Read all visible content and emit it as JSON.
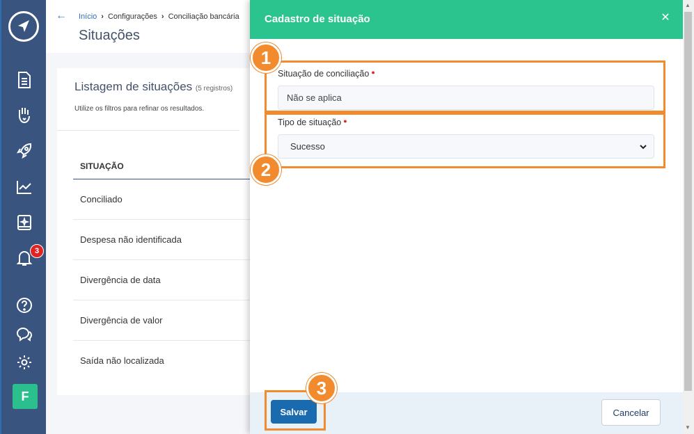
{
  "sidebar": {
    "badge_count": "3",
    "avatar_letter": "F"
  },
  "header": {
    "breadcrumb": {
      "home": "Início",
      "item2": "Configurações",
      "item3": "Conciliação bancária"
    },
    "page_title": "Situações"
  },
  "list": {
    "title": "Listagem de situações",
    "count": "(5 registros)",
    "subtitle": "Utilize os filtros para refinar os resultados.",
    "column_header": "SITUAÇÃO",
    "rows": [
      "Conciliado",
      "Despesa não identificada",
      "Divergência de data",
      "Divergência de valor",
      "Saída não localizada"
    ]
  },
  "modal": {
    "title": "Cadastro de situação",
    "field1_label": "Situação de conciliação",
    "field1_value": "Não se aplica",
    "field2_label": "Tipo de situação",
    "field2_value": "Sucesso",
    "save_label": "Salvar",
    "cancel_label": "Cancelar"
  },
  "annotations": {
    "n1": "1",
    "n2": "2",
    "n3": "3"
  },
  "colors": {
    "accent": "#2bc38e",
    "sidebar": "#3a5480",
    "primary": "#1a6ab0",
    "annotation": "#f28a2e"
  }
}
